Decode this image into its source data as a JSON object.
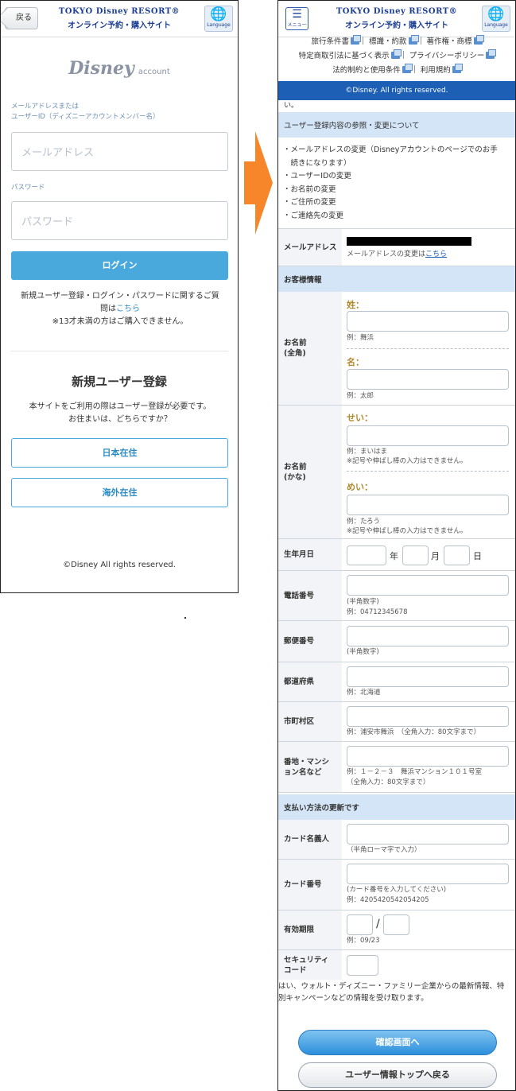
{
  "brand": {
    "line1": "TOKYO Disney RESORT®",
    "line2": "オンライン予約・購入サイト"
  },
  "language_label": "Language",
  "menu_label": "メニュー",
  "login": {
    "back_label": "戻る",
    "logo_main": "Disney",
    "logo_sub": "account",
    "email_label_1": "メールアドレスまたは",
    "email_label_2": "ユーザーID（ディズニーアカウントメンバー名）",
    "email_placeholder": "メールアドレス",
    "password_label": "パスワード",
    "password_placeholder": "パスワード",
    "login_button": "ログイン",
    "help_text_1": "新規ユーザー登録・ログイン・パスワードに関するご質",
    "help_text_2": "問は",
    "help_link": "こちら",
    "age_notice": "※13才未満の方はご購入できません。",
    "register_title": "新規ユーザー登録",
    "register_desc_1": "本サイトをご利用の際はユーザー登録が必要です。",
    "register_desc_2": "お住まいは、どちらですか？",
    "japan_button": "日本在住",
    "overseas_button": "海外在住",
    "copyright": "©Disney All rights reserved."
  },
  "right": {
    "links": {
      "travel_terms": "旅行条件書",
      "terms": "標識・約款",
      "copyright_tm": "著作権・商標",
      "tokutei": "特定商取引法に基づく表示",
      "privacy": "プライバシーポリシー",
      "legal": "法的制約と使用条件",
      "terms_of_use": "利用規約"
    },
    "footer_copyright": "©Disney. All rights reserved.",
    "cut_text": "い。",
    "section_ref": "ユーザー登録内容の参照・変更について",
    "ref_items": [
      "・メールアドレスの変更（Disneyアカウントのページでのお手",
      "　続きになります）",
      "・ユーザーIDの変更",
      "・お名前の変更",
      "・ご住所の変更",
      "・ご連絡先の変更"
    ],
    "email_row_label": "メールアドレス",
    "email_change_text": "メールアドレスの変更は",
    "email_change_link": "こちら",
    "section_customer": "お客様情報",
    "name_kanji_label": "お名前\n(全角)",
    "sei_label": "姓：",
    "sei_example": "例：舞浜",
    "mei_label": "名：",
    "mei_example": "例：太郎",
    "name_kana_label": "お名前\n(かな)",
    "sei_kana_label": "せい：",
    "sei_kana_example": "例：まいはま",
    "kana_notice": "※記号や伸ばし棒の入力はできません。",
    "mei_kana_label": "めい：",
    "mei_kana_example": "例：たろう",
    "birthday_label": "生年月日",
    "year_unit": "年",
    "month_unit": "月",
    "day_unit": "日",
    "phone_label": "電話番号",
    "phone_hint": "(半角数字)",
    "phone_example": "例：04712345678",
    "zip_label": "郵便番号",
    "zip_hint": "(半角数字)",
    "pref_label": "都道府県",
    "pref_example": "例：北海道",
    "city_label": "市町村区",
    "city_example": "例：浦安市舞浜　（全角入力：80文字まで）",
    "address_label": "番地・マンション名など",
    "address_example_1": "例：１－２－３　舞浜マンション１０１号室",
    "address_example_2": "（全角入力：80文字まで）",
    "section_payment": "支払い方法の更新です",
    "card_name_label": "カード名義人",
    "card_name_hint": "（半角ローマ字で入力）",
    "card_number_label": "カード番号",
    "card_number_hint": "(カード番号を入力してください)",
    "card_number_example": "例：4205420542054205",
    "expiry_label": "有効期限",
    "expiry_slash": "/",
    "expiry_example": "例：09/23",
    "security_label": "セキュリティコード",
    "consent_text_1": "はい、ウォルト・ディズニー・ファミリー企業からの最新情報、特",
    "consent_text_2": "別キャンペーンなどの情報を受け取ります。",
    "confirm_button": "確認画面へ",
    "back_top_button": "ユーザー情報トップへ戻る"
  },
  "colors": {
    "primary": "#49a9dd",
    "brand": "#1c3f94",
    "section": "#d3e5f6",
    "footer": "#1d5fb4",
    "arrow": "#f7862a"
  }
}
